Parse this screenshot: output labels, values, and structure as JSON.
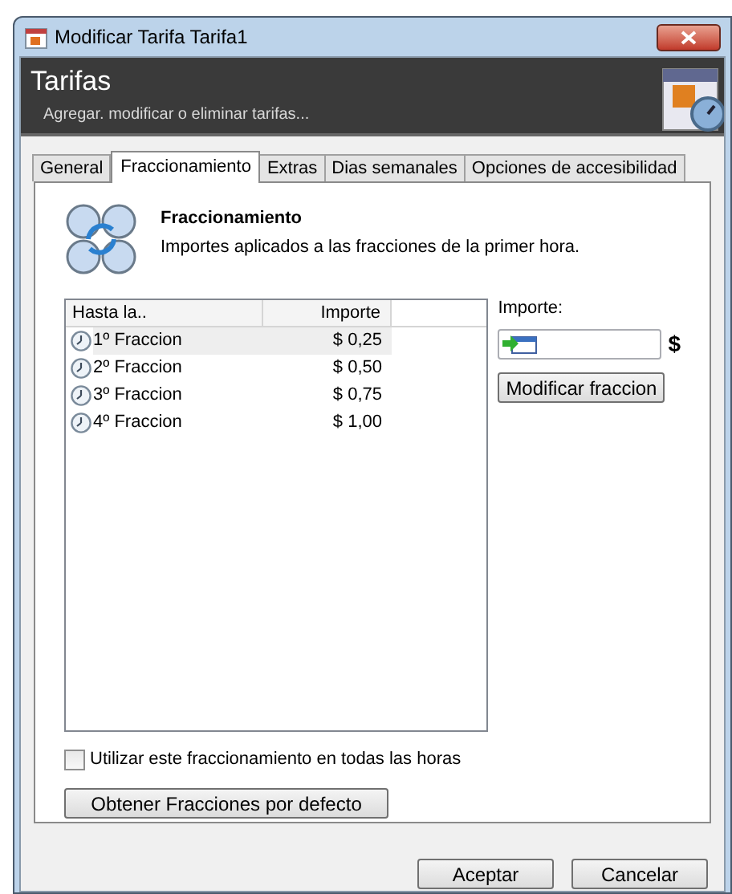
{
  "window": {
    "title": "Modificar Tarifa Tarifa1"
  },
  "header": {
    "title": "Tarifas",
    "subtitle": "Agregar. modificar o eliminar tarifas..."
  },
  "tabs": [
    {
      "label": "General",
      "selected": false
    },
    {
      "label": "Fraccionamiento",
      "selected": true
    },
    {
      "label": "Extras",
      "selected": false
    },
    {
      "label": "Dias semanales",
      "selected": false
    },
    {
      "label": "Opciones de accesibilidad",
      "selected": false
    }
  ],
  "section": {
    "title": "Fraccionamiento",
    "description": "Importes aplicados a las fracciones de la primer hora."
  },
  "table": {
    "columns": [
      "Hasta la..",
      "Importe"
    ],
    "rows": [
      {
        "name": "1º Fraccion",
        "amount": "$ 0,25",
        "selected": true
      },
      {
        "name": "2º Fraccion",
        "amount": "$ 0,50",
        "selected": false
      },
      {
        "name": "3º Fraccion",
        "amount": "$ 0,75",
        "selected": false
      },
      {
        "name": "4º Fraccion",
        "amount": "$ 1,00",
        "selected": false
      }
    ]
  },
  "importe": {
    "label": "Importe:",
    "currency": "$",
    "button": "Modificar fraccion"
  },
  "checkbox": {
    "label": "Utilizar este fraccionamiento en todas las horas",
    "checked": false
  },
  "default_button": "Obtener Fracciones por defecto",
  "buttons": [
    "Aceptar",
    "Cancelar"
  ]
}
